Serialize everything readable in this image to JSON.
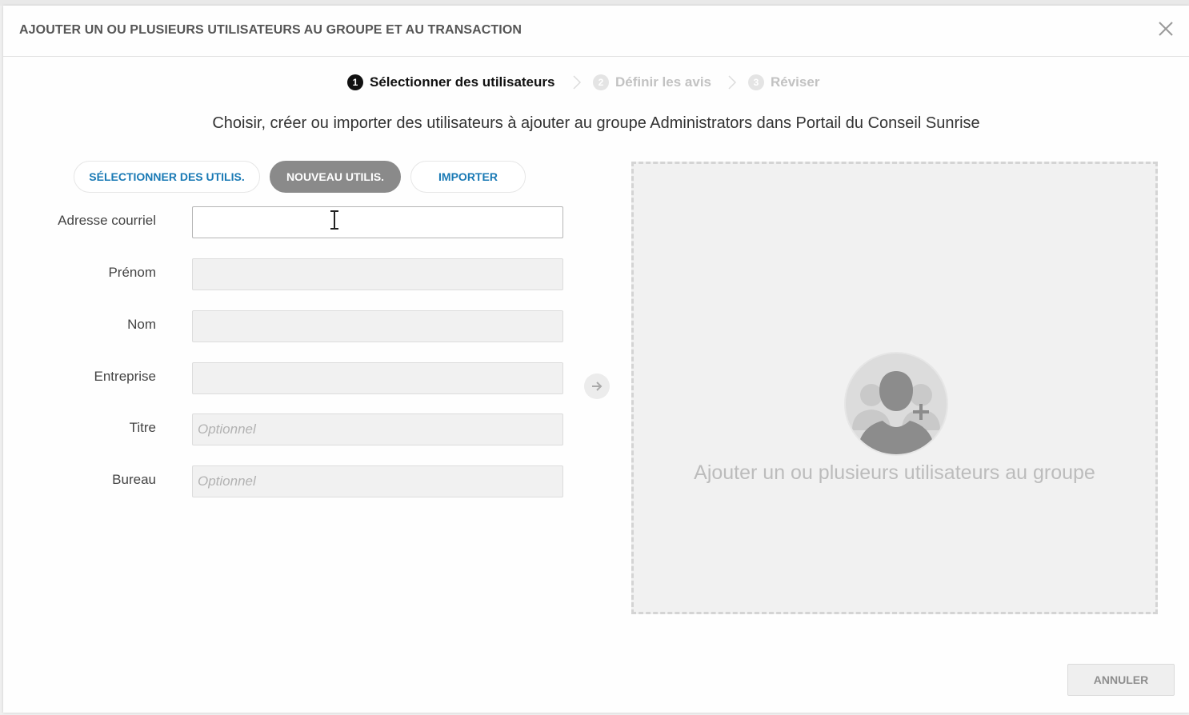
{
  "dialog": {
    "title": "AJOUTER UN OU PLUSIEURS UTILISATEURS AU GROUPE ET AU TRANSACTION",
    "close_icon": "close-icon"
  },
  "steps": [
    {
      "number": "1",
      "label": "Sélectionner des utilisateurs",
      "state": "active"
    },
    {
      "number": "2",
      "label": "Définir les avis",
      "state": "inactive"
    },
    {
      "number": "3",
      "label": "Réviser",
      "state": "inactive"
    }
  ],
  "subtitle": "Choisir, créer ou importer des utilisateurs à ajouter au groupe Administrators dans Portail du Conseil Sunrise",
  "tabs": [
    {
      "label": "SÉLECTIONNER DES UTILIS.",
      "active": false
    },
    {
      "label": "NOUVEAU UTILIS.",
      "active": true
    },
    {
      "label": "IMPORTER",
      "active": false
    }
  ],
  "form": {
    "email": {
      "label": "Adresse courriel",
      "value": "",
      "placeholder": ""
    },
    "first_name": {
      "label": "Prénom",
      "value": "",
      "placeholder": ""
    },
    "last_name": {
      "label": "Nom",
      "value": "",
      "placeholder": ""
    },
    "company": {
      "label": "Entreprise",
      "value": "",
      "placeholder": ""
    },
    "title": {
      "label": "Titre",
      "value": "",
      "placeholder": "Optionnel"
    },
    "office": {
      "label": "Bureau",
      "value": "",
      "placeholder": "Optionnel"
    }
  },
  "add_arrow_icon": "arrow-right-icon",
  "drop_zone": {
    "icon": "add-users-icon",
    "text": "Ajouter un ou plusieurs utilisateurs au groupe"
  },
  "footer": {
    "cancel_label": "ANNULER"
  },
  "colors": {
    "link_blue": "#1a7ab5",
    "active_tab_bg": "#8a8a8a",
    "active_step": "#111111",
    "inactive_step": "#c2c2c2"
  }
}
